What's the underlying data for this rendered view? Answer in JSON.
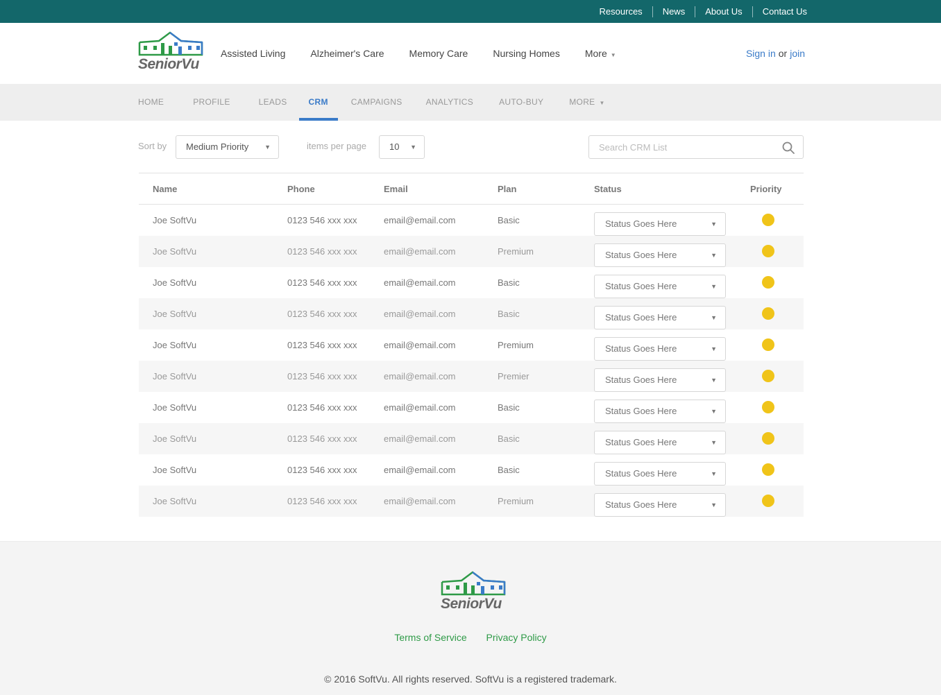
{
  "topbar": {
    "links": [
      "Resources",
      "News",
      "About Us",
      "Contact Us"
    ]
  },
  "brand": {
    "name": "SeniorVu"
  },
  "mainnav": {
    "items": [
      "Assisted Living",
      "Alzheimer's Care",
      "Memory Care",
      "Nursing Homes",
      "More"
    ]
  },
  "auth": {
    "sign_in": "Sign in",
    "or": "or",
    "join": "join"
  },
  "subnav": {
    "items": [
      "HOME",
      "PROFILE",
      "LEADS",
      "CRM",
      "CAMPAIGNS",
      "ANALYTICS",
      "AUTO-BUY",
      "MORE"
    ],
    "active": "CRM"
  },
  "controls": {
    "sort_label": "Sort by",
    "sort_value": "Medium Priority",
    "per_page_label": "items per page",
    "per_page_value": "10",
    "search_placeholder": "Search CRM List"
  },
  "table": {
    "headers": {
      "name": "Name",
      "phone": "Phone",
      "email": "Email",
      "plan": "Plan",
      "status": "Status",
      "priority": "Priority"
    },
    "rows": [
      {
        "name": "Joe SoftVu",
        "phone": "0123 546 xxx xxx",
        "email": "email@email.com",
        "plan": "Basic",
        "status": "Status Goes Here"
      },
      {
        "name": "Joe SoftVu",
        "phone": "0123 546 xxx xxx",
        "email": "email@email.com",
        "plan": "Premium",
        "status": "Status Goes Here"
      },
      {
        "name": "Joe SoftVu",
        "phone": "0123 546 xxx xxx",
        "email": "email@email.com",
        "plan": "Basic",
        "status": "Status Goes Here"
      },
      {
        "name": "Joe SoftVu",
        "phone": "0123 546 xxx xxx",
        "email": "email@email.com",
        "plan": "Basic",
        "status": "Status Goes Here"
      },
      {
        "name": "Joe SoftVu",
        "phone": "0123 546 xxx xxx",
        "email": "email@email.com",
        "plan": "Premium",
        "status": "Status Goes Here"
      },
      {
        "name": "Joe SoftVu",
        "phone": "0123 546 xxx xxx",
        "email": "email@email.com",
        "plan": "Premier",
        "status": "Status Goes Here"
      },
      {
        "name": "Joe SoftVu",
        "phone": "0123 546 xxx xxx",
        "email": "email@email.com",
        "plan": "Basic",
        "status": "Status Goes Here"
      },
      {
        "name": "Joe SoftVu",
        "phone": "0123 546 xxx xxx",
        "email": "email@email.com",
        "plan": "Basic",
        "status": "Status Goes Here"
      },
      {
        "name": "Joe SoftVu",
        "phone": "0123 546 xxx xxx",
        "email": "email@email.com",
        "plan": "Basic",
        "status": "Status Goes Here"
      },
      {
        "name": "Joe SoftVu",
        "phone": "0123 546 xxx xxx",
        "email": "email@email.com",
        "plan": "Premium",
        "status": "Status Goes Here"
      }
    ]
  },
  "footer": {
    "links": [
      "Terms of Service",
      "Privacy Policy"
    ],
    "copyright": "© 2016 SoftVu. All rights reserved. SoftVu is a registered trademark."
  },
  "colors": {
    "topbar": "#13676a",
    "accent": "#3a7bc8",
    "priority_medium": "#f0c419",
    "footer_link": "#2e9a47"
  }
}
